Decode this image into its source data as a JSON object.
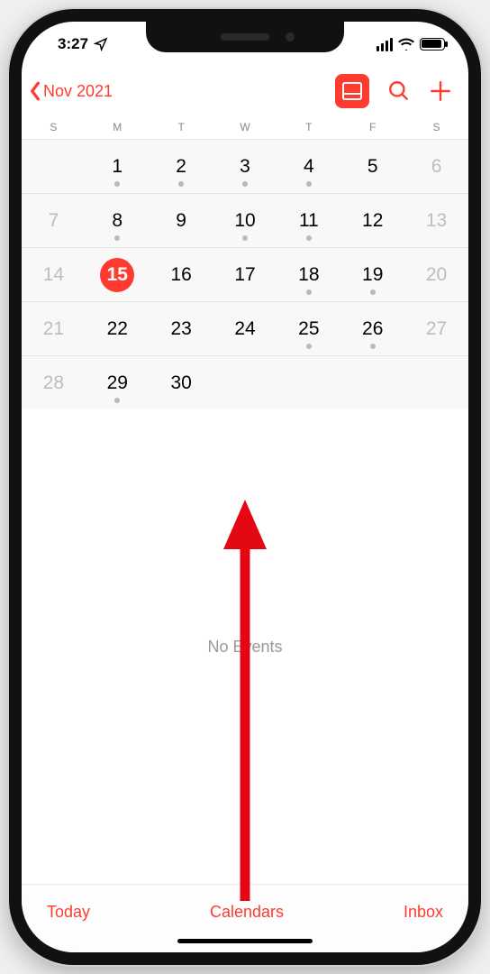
{
  "status": {
    "time": "3:27"
  },
  "nav": {
    "back_label": "Nov 2021"
  },
  "weekdays": [
    "S",
    "M",
    "T",
    "W",
    "T",
    "F",
    "S"
  ],
  "calendar": {
    "rows": [
      [
        {
          "num": "",
          "dim": true,
          "event": false,
          "selected": false
        },
        {
          "num": "1",
          "dim": false,
          "event": true,
          "selected": false
        },
        {
          "num": "2",
          "dim": false,
          "event": true,
          "selected": false
        },
        {
          "num": "3",
          "dim": false,
          "event": true,
          "selected": false
        },
        {
          "num": "4",
          "dim": false,
          "event": true,
          "selected": false
        },
        {
          "num": "5",
          "dim": false,
          "event": false,
          "selected": false
        },
        {
          "num": "6",
          "dim": true,
          "event": false,
          "selected": false
        }
      ],
      [
        {
          "num": "7",
          "dim": true,
          "event": false,
          "selected": false
        },
        {
          "num": "8",
          "dim": false,
          "event": true,
          "selected": false
        },
        {
          "num": "9",
          "dim": false,
          "event": false,
          "selected": false
        },
        {
          "num": "10",
          "dim": false,
          "event": true,
          "selected": false
        },
        {
          "num": "11",
          "dim": false,
          "event": true,
          "selected": false
        },
        {
          "num": "12",
          "dim": false,
          "event": false,
          "selected": false
        },
        {
          "num": "13",
          "dim": true,
          "event": false,
          "selected": false
        }
      ],
      [
        {
          "num": "14",
          "dim": true,
          "event": false,
          "selected": false
        },
        {
          "num": "15",
          "dim": false,
          "event": false,
          "selected": true
        },
        {
          "num": "16",
          "dim": false,
          "event": false,
          "selected": false
        },
        {
          "num": "17",
          "dim": false,
          "event": false,
          "selected": false
        },
        {
          "num": "18",
          "dim": false,
          "event": true,
          "selected": false
        },
        {
          "num": "19",
          "dim": false,
          "event": true,
          "selected": false
        },
        {
          "num": "20",
          "dim": true,
          "event": false,
          "selected": false
        }
      ],
      [
        {
          "num": "21",
          "dim": true,
          "event": false,
          "selected": false
        },
        {
          "num": "22",
          "dim": false,
          "event": false,
          "selected": false
        },
        {
          "num": "23",
          "dim": false,
          "event": false,
          "selected": false
        },
        {
          "num": "24",
          "dim": false,
          "event": false,
          "selected": false
        },
        {
          "num": "25",
          "dim": false,
          "event": true,
          "selected": false
        },
        {
          "num": "26",
          "dim": false,
          "event": true,
          "selected": false
        },
        {
          "num": "27",
          "dim": true,
          "event": false,
          "selected": false
        }
      ],
      [
        {
          "num": "28",
          "dim": true,
          "event": false,
          "selected": false
        },
        {
          "num": "29",
          "dim": false,
          "event": true,
          "selected": false
        },
        {
          "num": "30",
          "dim": false,
          "event": false,
          "selected": false
        },
        {
          "num": "",
          "dim": true,
          "event": false,
          "selected": false
        },
        {
          "num": "",
          "dim": true,
          "event": false,
          "selected": false
        },
        {
          "num": "",
          "dim": true,
          "event": false,
          "selected": false
        },
        {
          "num": "",
          "dim": true,
          "event": false,
          "selected": false
        }
      ]
    ]
  },
  "events": {
    "empty_label": "No Events"
  },
  "toolbar": {
    "today": "Today",
    "calendars": "Calendars",
    "inbox": "Inbox"
  }
}
